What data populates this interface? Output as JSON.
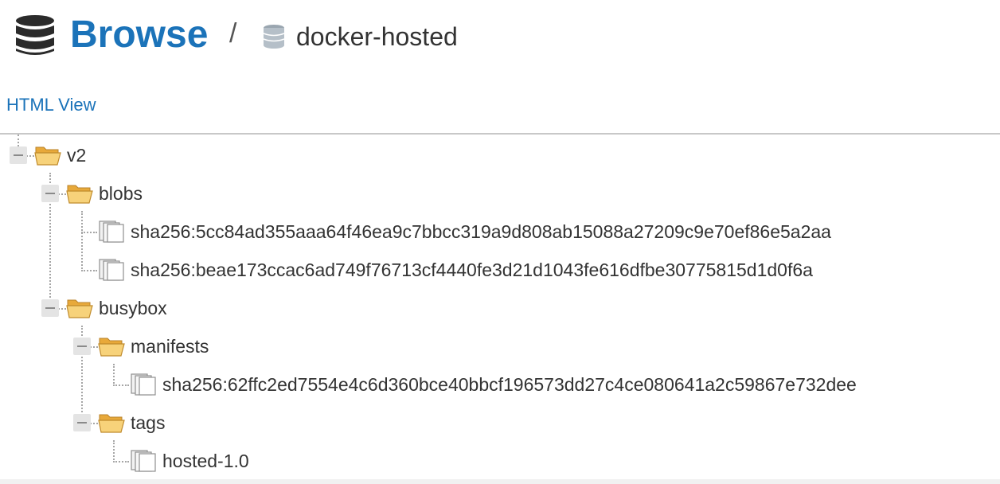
{
  "header": {
    "title": "Browse",
    "separator": "/",
    "repository": "docker-hosted"
  },
  "view_toggle": "HTML View",
  "tree": {
    "v2": "v2",
    "blobs": "blobs",
    "blob_1": "sha256:5cc84ad355aaa64f46ea9c7bbcc319a9d808ab15088a27209c9e70ef86e5a2aa",
    "blob_2": "sha256:beae173ccac6ad749f76713cf4440fe3d21d1043fe616dfbe30775815d1d0f6a",
    "busybox": "busybox",
    "manifests": "manifests",
    "manifest_1": "sha256:62ffc2ed7554e4c6d360bce40bbcf196573dd27c4ce080641a2c59867e732dee",
    "tags": "tags",
    "tag_1": "hosted-1.0"
  },
  "colors": {
    "accent": "#1b73b9",
    "folder": "#f3c45a",
    "text": "#333333"
  }
}
